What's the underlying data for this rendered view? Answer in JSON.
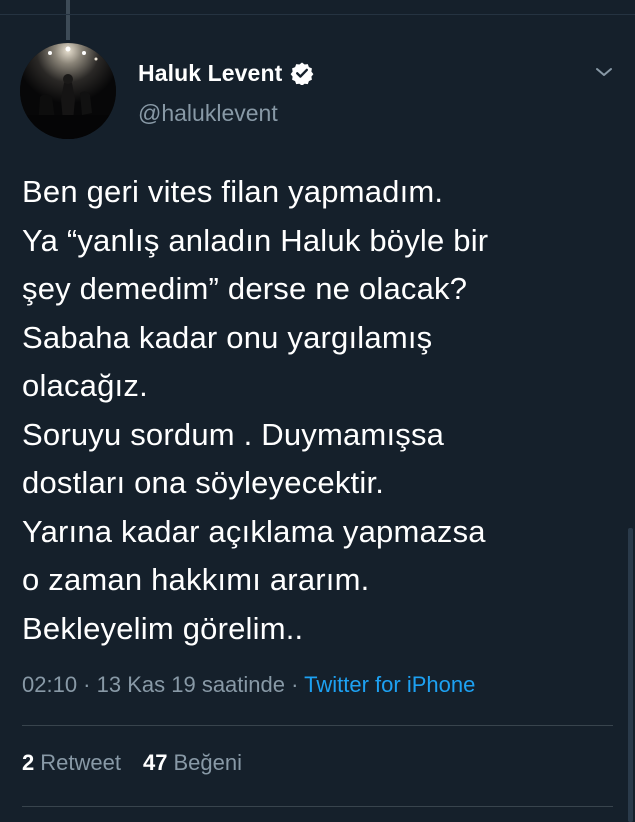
{
  "author": {
    "name": "Haluk Levent",
    "handle": "@haluklevent",
    "verified": true,
    "avatar_icon": "avatar-concert-photo"
  },
  "tweet": {
    "lines": [
      "Ben geri vites filan yapmadım.",
      "Ya “yanlış anladın Haluk böyle bir",
      "şey demedim” derse ne olacak?",
      "Sabaha kadar onu yargılamış",
      "olacağız.",
      "Soruyu sordum . Duymamışsa",
      "dostları ona söyleyecektir.",
      "Yarına kadar açıklama yapmazsa",
      "o zaman hakkımı ararım.",
      "Bekleyelim görelim.."
    ]
  },
  "meta": {
    "time": "02:10",
    "sep1": " · ",
    "date": "13 Kas 19 saatinde",
    "sep2": " · ",
    "source": "Twitter for iPhone"
  },
  "stats": {
    "retweets_count": "2",
    "retweets_label": "Retweet",
    "likes_count": "47",
    "likes_label": "Beğeni"
  },
  "colors": {
    "background": "#15202b",
    "text": "#ffffff",
    "secondary": "#8899a6",
    "link": "#1da1f2",
    "divider": "#38444d"
  },
  "icons": {
    "verified": "verified-badge-icon",
    "menu": "chevron-down-icon"
  }
}
